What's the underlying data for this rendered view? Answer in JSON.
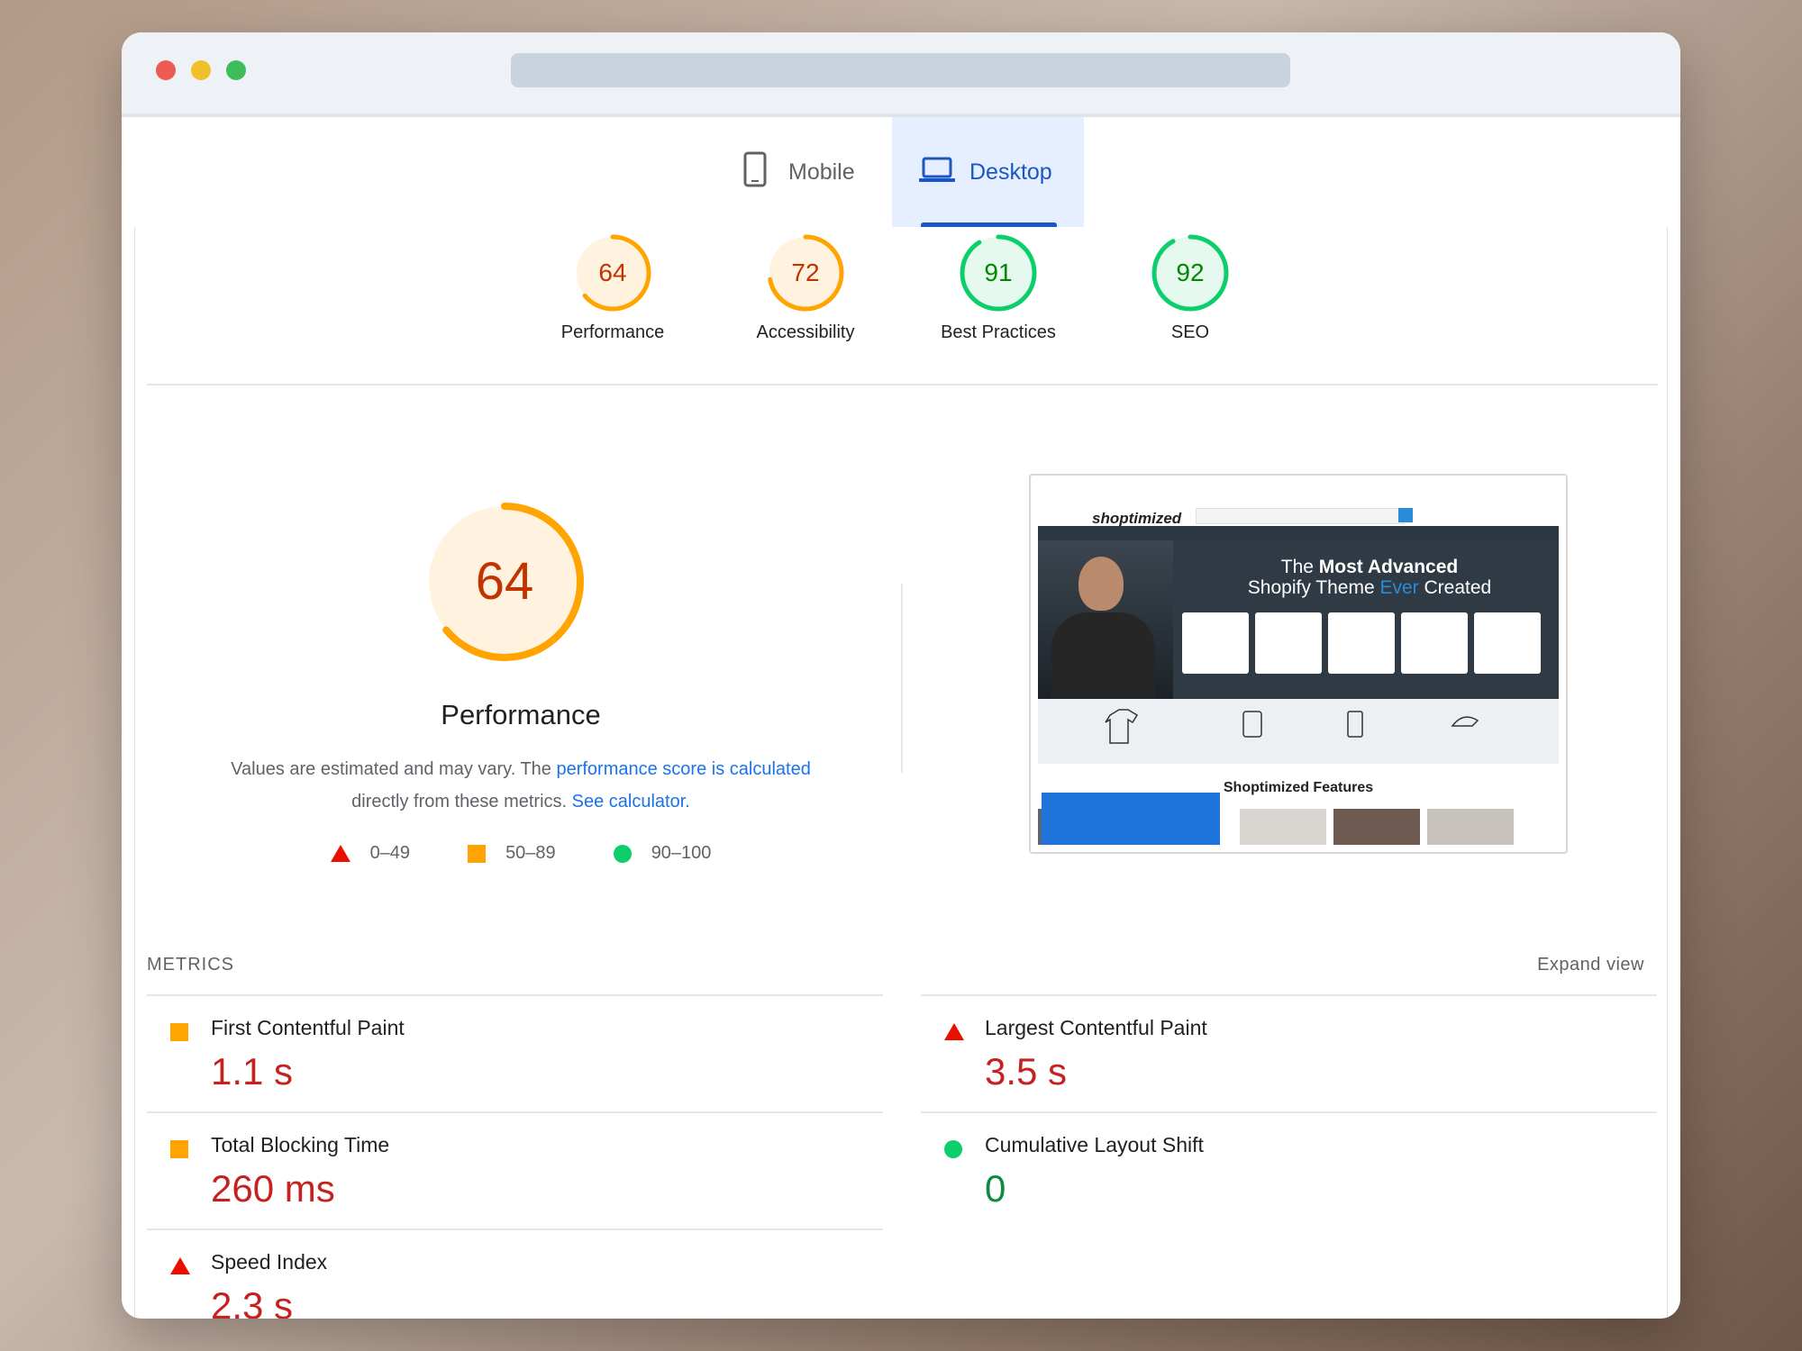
{
  "tabs": {
    "mobile_label": "Mobile",
    "desktop_label": "Desktop",
    "active": "Desktop"
  },
  "summary_scores": [
    {
      "label": "Performance",
      "score": "64",
      "status": "average"
    },
    {
      "label": "Accessibility",
      "score": "72",
      "status": "average"
    },
    {
      "label": "Best Practices",
      "score": "91",
      "status": "pass"
    },
    {
      "label": "SEO",
      "score": "92",
      "status": "pass"
    }
  ],
  "performance": {
    "score": "64",
    "title": "Performance",
    "desc_before": "Values are estimated and may vary. The ",
    "desc_link1": "performance score is calculated",
    "desc_middle": "directly from these metrics. ",
    "desc_link2": "See calculator."
  },
  "legend": [
    {
      "icon": "triangle-red-icon",
      "range": "0–49"
    },
    {
      "icon": "square-orange-icon",
      "range": "50–89"
    },
    {
      "icon": "circle-green-icon",
      "range": "90–100"
    }
  ],
  "screenshot": {
    "logo": "shoptimized",
    "hero_line1_prefix": "The ",
    "hero_line1_bold": "Most Advanced",
    "hero_line2_before": "Shopify Theme ",
    "hero_line2_accent": "Ever",
    "hero_line2_after": " Created",
    "features_title": "Shoptimized Features"
  },
  "metrics": {
    "header": "METRICS",
    "expand_label": "Expand view",
    "items": [
      {
        "name": "First Contentful Paint",
        "value": "1.1 s",
        "status": "average"
      },
      {
        "name": "Largest Contentful Paint",
        "value": "3.5 s",
        "status": "fail"
      },
      {
        "name": "Total Blocking Time",
        "value": "260 ms",
        "status": "average"
      },
      {
        "name": "Cumulative Layout Shift",
        "value": "0",
        "status": "pass"
      },
      {
        "name": "Speed Index",
        "value": "2.3 s",
        "status": "fail"
      }
    ]
  },
  "colors": {
    "fail": "#eb0f00",
    "average": "#ffa400",
    "pass": "#0cce6b",
    "average_text": "#c33300",
    "pass_text": "#008800",
    "link": "#1a73e8",
    "tab_active": "#1a56c4"
  }
}
